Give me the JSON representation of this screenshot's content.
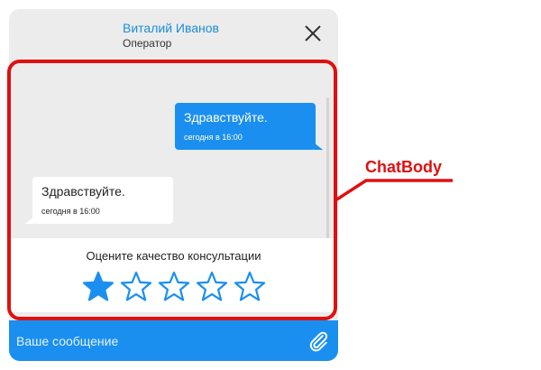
{
  "header": {
    "operator_name": "Виталий Иванов",
    "operator_role": "Оператор",
    "close_icon": "close-icon"
  },
  "chat": {
    "messages": [
      {
        "direction": "outgoing",
        "text": "Здравствуйте.",
        "time": "сегодня в 16:00"
      },
      {
        "direction": "incoming",
        "text": "Здравствуйте.",
        "time": "сегодня в 16:00"
      }
    ],
    "rating": {
      "label": "Оцените качество консультации",
      "max": 5,
      "value": 1
    }
  },
  "composer": {
    "placeholder": "Ваше сообщение",
    "attach_icon": "paperclip-icon"
  },
  "annotation": {
    "label": "ChatBody",
    "color": "#e01010"
  },
  "colors": {
    "accent": "#1a8ff0",
    "operator_name": "#1a8fd6",
    "background": "#ececec"
  }
}
